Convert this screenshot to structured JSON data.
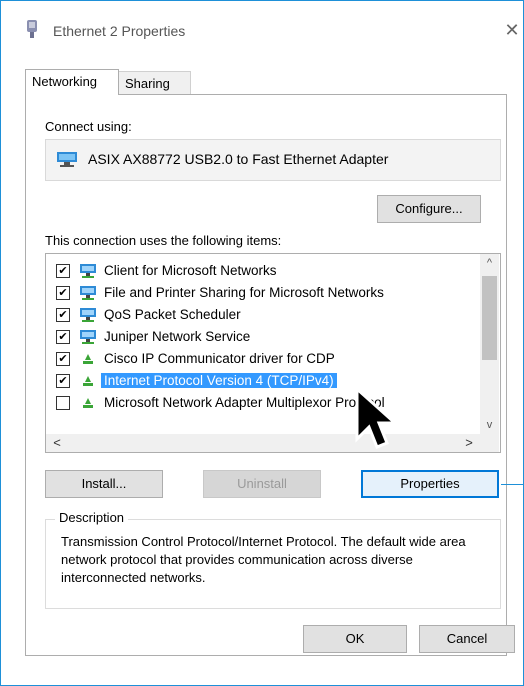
{
  "window": {
    "title": "Ethernet 2 Properties",
    "close_glyph": "✕"
  },
  "tabs": [
    {
      "label": "Networking",
      "active": true
    },
    {
      "label": "Sharing",
      "active": false
    }
  ],
  "connect_using": {
    "label": "Connect using:",
    "adapter": "ASIX AX88772 USB2.0 to Fast Ethernet Adapter",
    "adapter_icon": "network-adapter-icon"
  },
  "buttons": {
    "configure": "Configure...",
    "install": "Install...",
    "uninstall": "Uninstall",
    "properties": "Properties",
    "ok": "OK",
    "cancel": "Cancel"
  },
  "items_label": "This connection uses the following items:",
  "items": [
    {
      "label": "Client for Microsoft Networks",
      "checked": true,
      "icon": "network-client-icon"
    },
    {
      "label": "File and Printer Sharing for Microsoft Networks",
      "checked": true,
      "icon": "network-client-icon"
    },
    {
      "label": "QoS Packet Scheduler",
      "checked": true,
      "icon": "network-client-icon"
    },
    {
      "label": "Juniper Network Service",
      "checked": true,
      "icon": "network-client-icon"
    },
    {
      "label": "Cisco IP Communicator driver for CDP",
      "checked": true,
      "icon": "protocol-icon"
    },
    {
      "label": "Internet Protocol Version 4 (TCP/IPv4)",
      "checked": true,
      "icon": "protocol-icon",
      "selected": true
    },
    {
      "label": "Microsoft Network Adapter Multiplexor Protocol",
      "checked": false,
      "icon": "protocol-icon"
    }
  ],
  "scroll": {
    "up": "^",
    "down": "v",
    "left": "<",
    "right": ">"
  },
  "description": {
    "title": "Description",
    "text": "Transmission Control Protocol/Internet Protocol. The default wide area network protocol that provides communication across diverse interconnected networks."
  },
  "check_glyph": "✔",
  "colors": {
    "selection": "#3399ff",
    "accent": "#1e90d8"
  }
}
